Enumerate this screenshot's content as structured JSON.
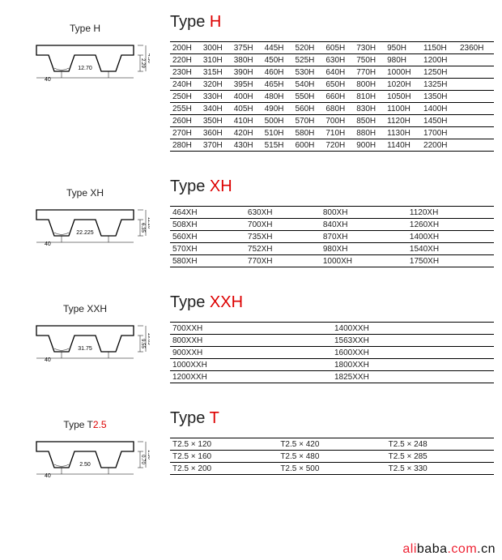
{
  "sections": [
    {
      "heading_prefix": "Type ",
      "heading_suffix": "H",
      "diagram_title_prefix": "Type ",
      "diagram_title_suffix": "H",
      "diagram_title_suffix_red": "",
      "pitch": "12.70",
      "angle": "40",
      "tooth_h": "2.29",
      "overall_h": "4.30",
      "rows": [
        [
          "200H",
          "300H",
          "375H",
          "445H",
          "520H",
          "605H",
          "730H",
          "950H",
          "1150H",
          "2360H"
        ],
        [
          "220H",
          "310H",
          "380H",
          "450H",
          "525H",
          "630H",
          "750H",
          "980H",
          "1200H",
          ""
        ],
        [
          "230H",
          "315H",
          "390H",
          "460H",
          "530H",
          "640H",
          "770H",
          "1000H",
          "1250H",
          ""
        ],
        [
          "240H",
          "320H",
          "395H",
          "465H",
          "540H",
          "650H",
          "800H",
          "1020H",
          "1325H",
          ""
        ],
        [
          "250H",
          "330H",
          "400H",
          "480H",
          "550H",
          "660H",
          "810H",
          "1050H",
          "1350H",
          ""
        ],
        [
          "255H",
          "340H",
          "405H",
          "490H",
          "560H",
          "680H",
          "830H",
          "1100H",
          "1400H",
          ""
        ],
        [
          "260H",
          "350H",
          "410H",
          "500H",
          "570H",
          "700H",
          "850H",
          "1120H",
          "1450H",
          ""
        ],
        [
          "270H",
          "360H",
          "420H",
          "510H",
          "580H",
          "710H",
          "880H",
          "1130H",
          "1700H",
          ""
        ],
        [
          "280H",
          "370H",
          "430H",
          "515H",
          "600H",
          "720H",
          "900H",
          "1140H",
          "2200H",
          ""
        ]
      ]
    },
    {
      "heading_prefix": "Type ",
      "heading_suffix": "XH",
      "diagram_title_prefix": "Type ",
      "diagram_title_suffix": "XH",
      "diagram_title_suffix_red": "",
      "pitch": "22.225",
      "angle": "40",
      "tooth_h": "6.35",
      "overall_h": "11.20",
      "rows": [
        [
          "464XH",
          "630XH",
          "800XH",
          "1120XH"
        ],
        [
          "508XH",
          "700XH",
          "840XH",
          "1260XH"
        ],
        [
          "560XH",
          "735XH",
          "870XH",
          "1400XH"
        ],
        [
          "570XH",
          "752XH",
          "980XH",
          "1540XH"
        ],
        [
          "580XH",
          "770XH",
          "1000XH",
          "1750XH"
        ]
      ]
    },
    {
      "heading_prefix": "Type ",
      "heading_suffix": "XXH",
      "diagram_title_prefix": "Type ",
      "diagram_title_suffix": "XXH",
      "diagram_title_suffix_red": "",
      "pitch": "31.75",
      "angle": "40",
      "tooth_h": "9.55",
      "overall_h": "19.05",
      "rows": [
        [
          "700XXH",
          "1400XXH"
        ],
        [
          "800XXH",
          "1563XXH"
        ],
        [
          "900XXH",
          "1600XXH"
        ],
        [
          "1000XXH",
          "1800XXH"
        ],
        [
          "1200XXH",
          "1825XXH"
        ]
      ]
    },
    {
      "heading_prefix": "Type ",
      "heading_suffix": "T",
      "diagram_title_prefix": "Type T",
      "diagram_title_suffix": "",
      "diagram_title_suffix_red": "2.5",
      "pitch": "2.50",
      "angle": "40",
      "tooth_h": "0.70",
      "overall_h": "1.30",
      "rows": [
        [
          "T2.5 × 120",
          "T2.5 × 420",
          "T2.5 × 248"
        ],
        [
          "T2.5 × 160",
          "T2.5 × 480",
          "T2.5 × 285"
        ],
        [
          "T2.5 × 200",
          "T2.5 × 500",
          "T2.5 × 330"
        ]
      ]
    }
  ],
  "watermark": {
    "p1": "ali",
    "p2": "baba",
    "p3": ".com",
    "p4": ".cn"
  }
}
